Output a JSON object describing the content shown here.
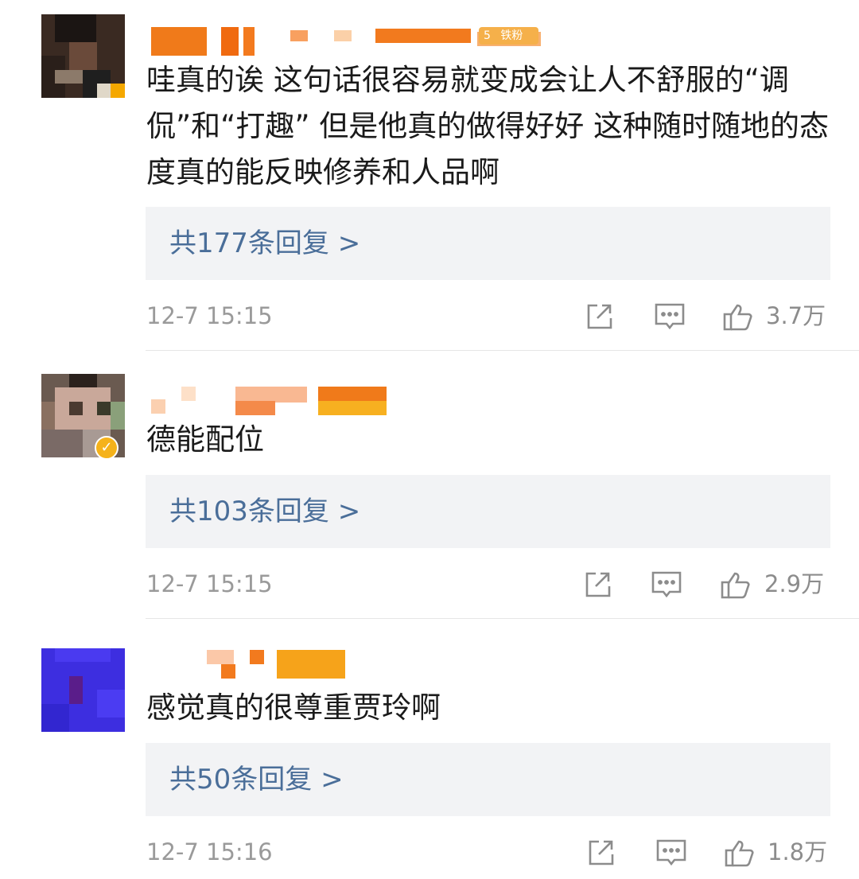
{
  "comments": [
    {
      "text": "哇真的诶 这句话很容易就变成会让人不舒服的“调侃”和“打趣” 但是他真的做得好好 这种随时随地的态度真的能反映修养和人品啊",
      "replies_label": "共177条回复 >",
      "time": "12-7 15:15",
      "likes": "3.7万",
      "badge_level": "5",
      "badge_label": "铁粉"
    },
    {
      "text": "德能配位",
      "replies_label": "共103条回复 >",
      "time": "12-7 15:15",
      "likes": "2.9万"
    },
    {
      "text": "感觉真的很尊重贾玲啊",
      "replies_label": "共50条回复 >",
      "time": "12-7 15:16",
      "likes": "1.8万"
    }
  ],
  "icons": {
    "verified": "✓",
    "share": "share-icon",
    "comment": "comment-icon",
    "like": "thumbs-up-icon"
  },
  "colors": {
    "reply_link": "#4a6e99",
    "reply_box_bg": "#f2f3f5",
    "meta_text": "#9a9a9a",
    "verified_badge": "#f5b21a"
  }
}
